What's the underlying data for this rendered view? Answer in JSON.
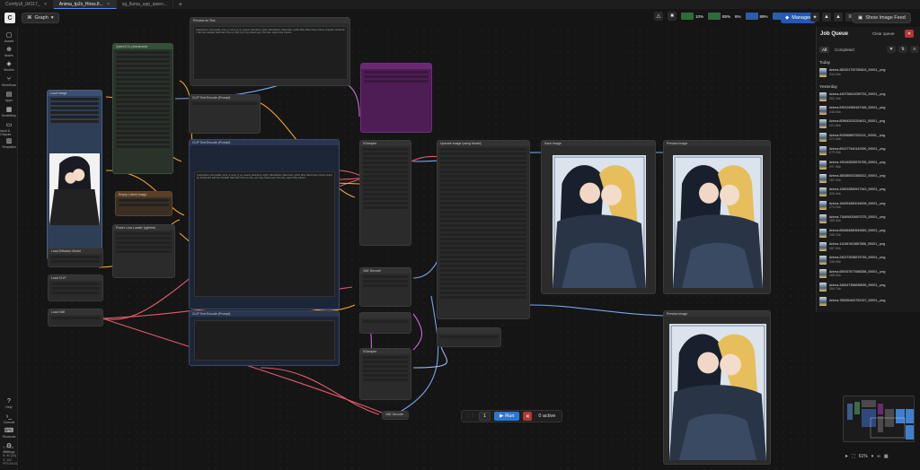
{
  "tabs": [
    {
      "label": "ComfyUI_04117_",
      "active": false
    },
    {
      "label": "Anima_tp2x_Hires.fi...",
      "active": true
    },
    {
      "label": "sg_llama_upp_qwen...",
      "active": false
    }
  ],
  "topbar": {
    "graph_label": "Graph",
    "stats": [
      {
        "label": "CPU",
        "value": "10%"
      },
      {
        "label": "RAM",
        "value": "85%"
      },
      {
        "label": "GPU",
        "value": "6%"
      },
      {
        "label": "VRAM",
        "value": "89%"
      },
      {
        "label": "Temp",
        "value": "45°"
      }
    ],
    "manager_label": "Manager",
    "image_feed_label": "Show Image Feed"
  },
  "leftbar": [
    {
      "label": "Assets",
      "icon": "cube-icon"
    },
    {
      "label": "Nodes",
      "icon": "nodes-icon"
    },
    {
      "label": "Models",
      "icon": "models-icon"
    },
    {
      "label": "Workflows",
      "icon": "workflow-icon"
    },
    {
      "label": "Apps",
      "icon": "apps-icon"
    },
    {
      "label": "ModelMap",
      "icon": "map-icon"
    },
    {
      "label": "Input & Outputs",
      "icon": "folder-icon"
    },
    {
      "label": "Templates",
      "icon": "template-icon"
    },
    {
      "label": "Help",
      "icon": "help-icon"
    },
    {
      "label": "Console",
      "icon": "console-icon"
    },
    {
      "label": "Shortcuts",
      "icon": "keyboard-icon"
    },
    {
      "label": "Settings",
      "icon": "gear-icon"
    }
  ],
  "status": [
    "T: 0.00s",
    "I: 0",
    "N: 40 [40]",
    "V: 162",
    "FPS:59.51"
  ],
  "run": {
    "qty": "1",
    "run_label": "Run",
    "active_label": "0 active"
  },
  "zoom": "61%",
  "job_queue": {
    "title": "Job Queue",
    "clear_label": "Clear queue",
    "tabs": [
      "All",
      "Completed"
    ],
    "today_label": "Today",
    "today": [
      {
        "name": "Anima-380321792765403_00001_.png",
        "size": "334.2kb"
      }
    ],
    "yesterday_label": "Yesterday",
    "yesterday": [
      {
        "name": "Anima-445726612099733_00001_.png",
        "size": "302.1kb"
      },
      {
        "name": "Anima-539124969187165_00001_.png",
        "size": "246.0kb"
      },
      {
        "name": "Anima-609642032204611_00001_.png",
        "size": "321.5kb"
      },
      {
        "name": "Anima-902685897203111_00001_.png",
        "size": "271.3kb"
      },
      {
        "name": "Anima-691277440142390_00001_.png",
        "size": "279.2kb"
      },
      {
        "name": "Anima-190162835576755_00001_.png",
        "size": "297.0kb"
      },
      {
        "name": "Anima-365389323365312_00001_.png",
        "size": "287.2kb"
      },
      {
        "name": "Anima-126022890917343_00001_.png",
        "size": "300.4kb"
      },
      {
        "name": "Anima-154991850016528_00001_.png",
        "size": "274.2kb"
      },
      {
        "name": "Anima-718490034907375_00001_.png",
        "size": "289.0kb"
      },
      {
        "name": "Anima-654664860549483_00001_.png",
        "size": "285.7kb"
      },
      {
        "name": "Anima-112461924667606_00001_.png",
        "size": "287.0kb"
      },
      {
        "name": "Anima-240273936575745_00001_.png",
        "size": "336.0kb"
      },
      {
        "name": "Anima-659157677696358_00001_.png",
        "size": "286.0kb"
      },
      {
        "name": "Anima-348447356636535_00001_.png",
        "size": "269.7kb"
      },
      {
        "name": "Anima-765390462752157_00001_.png",
        "size": ""
      }
    ]
  },
  "nodes": {
    "preview_as_text": "Preview as Text",
    "clip_text_encode": "CLIP Text Encode (Prompt)",
    "ksampler": "KSampler",
    "load_image": "Load Image",
    "save_image": "Save Image",
    "preview_image": "Preview Image",
    "upscale": "Upscale Image (using Model)",
    "load_clip": "Load CLIP",
    "load_vae": "Load VAE",
    "load_diffusion": "Load Diffusion Model",
    "power_lora": "Power Lora Loader (rgthree)",
    "empty_latent": "Empty Latent Image",
    "vae_decode": "VAE Decode",
    "qwen_vl": "Qwen3-VL (Advanced)",
    "prompt_text": "(masterpiece, best quality, score_9, score_8_up, newest, absurdres), 2girls, lolita fashion, black dress, gothic lolita, frilled dress, bonnet, long hair, blonde hair, hair bow, twintails, black hair, hime cut, kiss, yuri, hug, closed eyes, from side, upper body, indoors..."
  }
}
